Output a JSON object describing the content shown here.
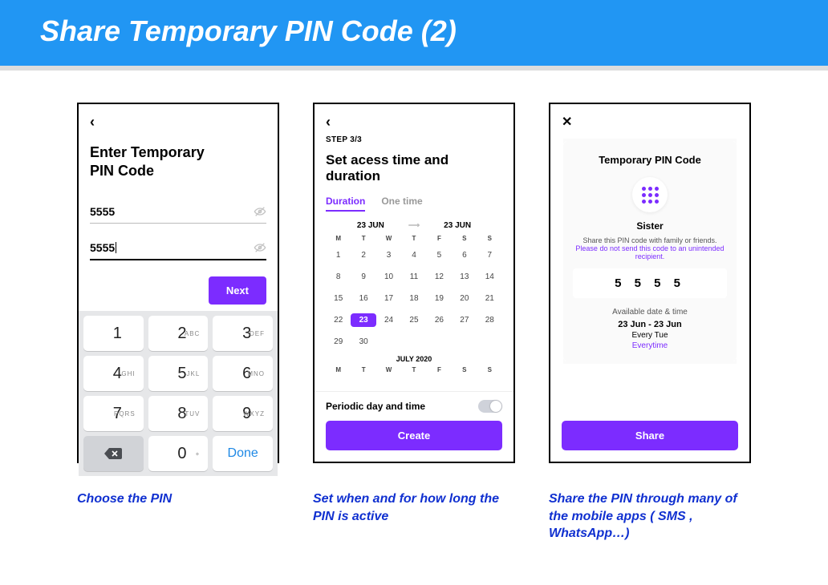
{
  "banner": {
    "title": "Share Temporary PIN Code (2)"
  },
  "screen1": {
    "title_line1": "Enter Temporary",
    "title_line2": "PIN Code",
    "pin1": "5555",
    "pin2": "5555",
    "next": "Next",
    "keypad": {
      "k1": "1",
      "k2": "2",
      "k3": "3",
      "k4": "4",
      "k5": "5",
      "k6": "6",
      "k7": "7",
      "k8": "8",
      "k9": "9",
      "k0": "0",
      "l2": "ABC",
      "l3": "DEF",
      "l4": "GHI",
      "l5": "JKL",
      "l6": "MNO",
      "l7": "PQRS",
      "l8": "TUV",
      "l9": "WXYZ",
      "l0": "+",
      "done": "Done"
    }
  },
  "screen2": {
    "step": "STEP 3/3",
    "title": "Set acess time and duration",
    "tab_duration": "Duration",
    "tab_onetime": "One time",
    "date_from": "23 JUN",
    "date_to": "23 JUN",
    "dow": [
      "M",
      "T",
      "W",
      "T",
      "F",
      "S",
      "S"
    ],
    "days": [
      "1",
      "2",
      "3",
      "4",
      "5",
      "6",
      "7",
      "8",
      "9",
      "10",
      "11",
      "12",
      "13",
      "14",
      "15",
      "16",
      "17",
      "18",
      "19",
      "20",
      "21",
      "22",
      "23",
      "24",
      "25",
      "26",
      "27",
      "28",
      "29",
      "30"
    ],
    "selected_day": "23",
    "next_month": "JULY 2020",
    "periodic_label": "Periodic day and time",
    "create": "Create"
  },
  "screen3": {
    "card_title": "Temporary PIN Code",
    "name": "Sister",
    "share_text": "Share this PIN code with family or friends.",
    "warn_text": "Please do not send this code to an unintended recipient.",
    "pin": "5 5 5 5",
    "avail_label": "Available date & time",
    "avail_dates": "23 Jun - 23 Jun",
    "avail_day": "Every Tue",
    "avail_time": "Everytime",
    "share": "Share"
  },
  "captions": {
    "c1": "Choose the PIN",
    "c2": "Set when and for how long the PIN is active",
    "c3": "Share the PIN through many of the mobile apps ( SMS , WhatsApp…)"
  }
}
